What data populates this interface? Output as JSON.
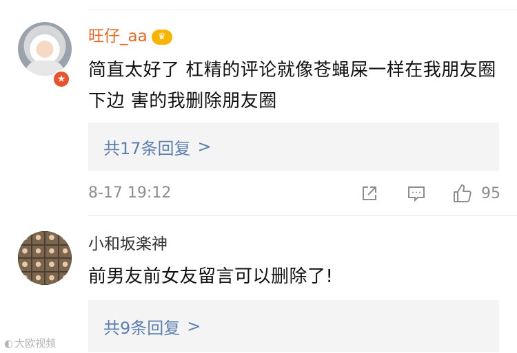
{
  "comments": [
    {
      "username": "旺仔_aa",
      "vip_badge": "♛",
      "content": "简直太好了 杠精的评论就像苍蝇屎一样在我朋友圈下边 害的我删除朋友圈",
      "replies_label": "共17条回复",
      "chevron": ">",
      "timestamp": "8-17 19:12",
      "like_count": "95",
      "accent_color": "#e86722"
    },
    {
      "username": "小和坂楽神",
      "content": "前男友前女友留言可以删除了!",
      "replies_label": "共9条回复",
      "chevron": ">"
    }
  ],
  "watermark": "大欧视频",
  "icons": {
    "share": "share-icon",
    "comment": "comment-icon",
    "like": "thumbs-up-icon",
    "verified": "verified-badge-icon"
  },
  "link_color": "#5b7fb1"
}
